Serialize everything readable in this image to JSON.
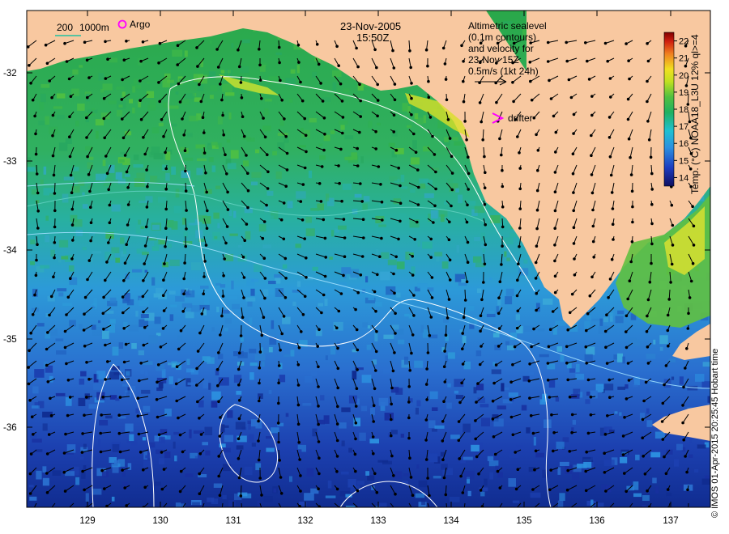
{
  "map": {
    "date": "23-Nov-2005",
    "time": "15:50Z",
    "legend_depth_200": "200",
    "legend_depth_1000": "1000m",
    "legend_argo": "Argo",
    "legend_drifter": "drifter",
    "altimetry_note": [
      "Altimetric sealevel",
      "(0.1m contours)",
      "and velocity for",
      "23-Nov 15Z",
      "0.5m/s (1kt 24h)"
    ],
    "colorbar_title": "Temp. (°C) NOAA18_L3U 12% ql>=4",
    "colorbar_ticks": [
      "22",
      "21",
      "20",
      "19",
      "18",
      "17",
      "16",
      "15",
      "14"
    ],
    "colorbar_range": [
      13.5,
      22.5
    ],
    "x_ticks": [
      "129",
      "130",
      "131",
      "132",
      "133",
      "134",
      "135",
      "136",
      "137"
    ],
    "y_ticks": [
      "-32",
      "-33",
      "-34",
      "-35",
      "-36"
    ],
    "copyright": "© IMOS 01-Apr-2015 20:25:45 Hobart time",
    "colors": {
      "land": "#f8c8a0",
      "ocean_warm": "#20a040",
      "ocean_mid": "#3aa8d8",
      "ocean_cold": "#1830a0",
      "argo_marker": "#ff00ff",
      "drifter_marker": "#ff00ff",
      "contour": "#ffffff",
      "depth_200": "#20c0a0",
      "depth_1000": "#a0e0ff"
    }
  }
}
